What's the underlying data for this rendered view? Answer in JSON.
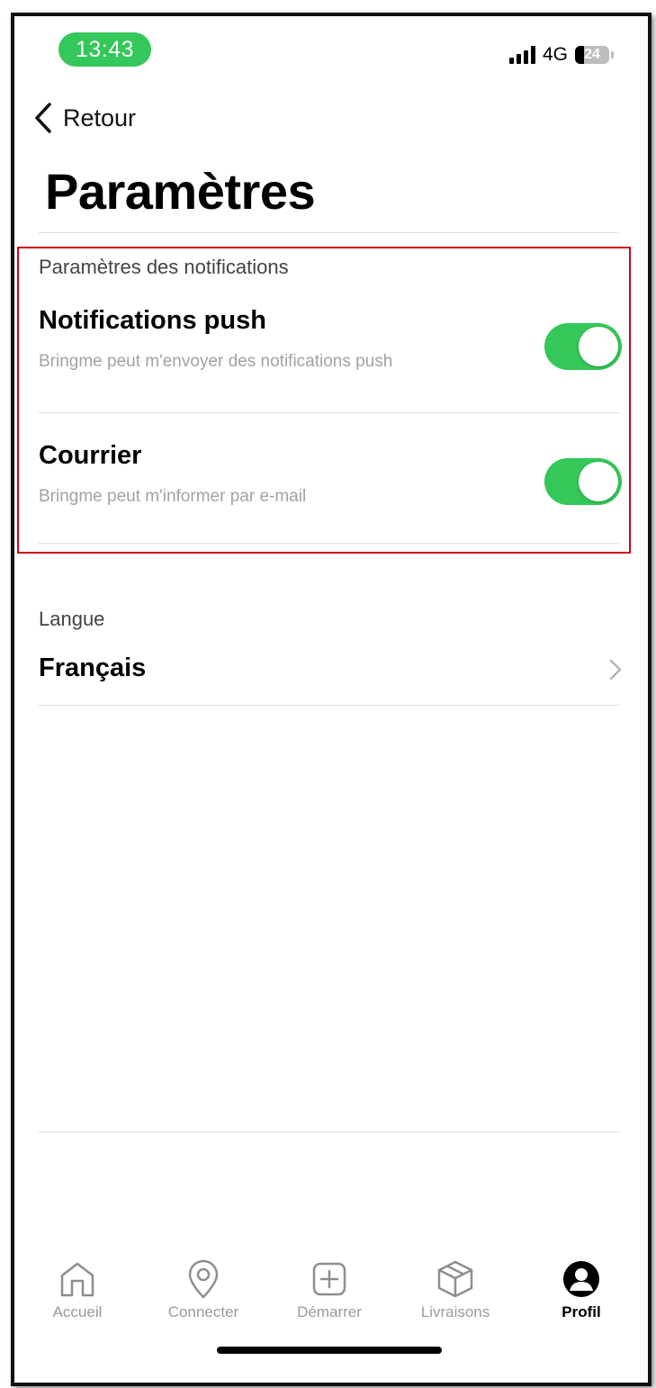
{
  "status_bar": {
    "time": "13:43",
    "network": "4G",
    "battery": "24"
  },
  "nav": {
    "back_label": "Retour"
  },
  "page": {
    "title": "Paramètres"
  },
  "notifications": {
    "section_label": "Paramètres des notifications",
    "items": [
      {
        "title": "Notifications push",
        "subtitle": "Bringme peut m'envoyer des notifications push",
        "enabled": true
      },
      {
        "title": "Courrier",
        "subtitle": "Bringme peut m'informer par e-mail",
        "enabled": true
      }
    ]
  },
  "language": {
    "section_label": "Langue",
    "value": "Français"
  },
  "tabbar": {
    "items": [
      {
        "label": "Accueil",
        "icon": "home-icon"
      },
      {
        "label": "Connecter",
        "icon": "location-pin-icon"
      },
      {
        "label": "Démarrer",
        "icon": "plus-square-icon"
      },
      {
        "label": "Livraisons",
        "icon": "package-icon"
      },
      {
        "label": "Profil",
        "icon": "profile-icon"
      }
    ],
    "active": "Profil"
  },
  "colors": {
    "toggle_on": "#34c759",
    "highlight": "#d0021b",
    "time_pill": "#34c759"
  }
}
